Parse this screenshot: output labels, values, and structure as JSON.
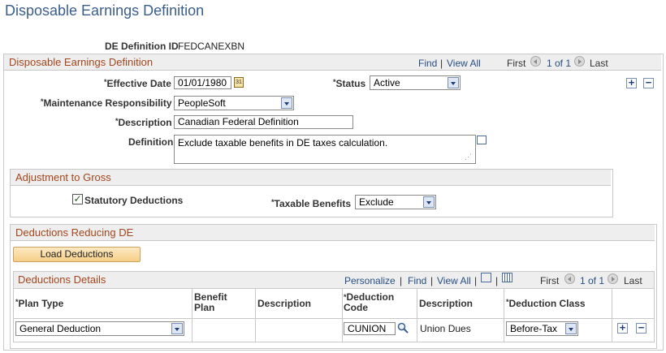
{
  "page": {
    "title": "Disposable Earnings Definition"
  },
  "header": {
    "id_label": "DE Definition ID",
    "id_value": "FEDCANEXBN"
  },
  "main": {
    "section_title": "Disposable Earnings Definition",
    "nav": {
      "find": "Find",
      "view_all": "View All",
      "first": "First",
      "count": "1 of 1",
      "last": "Last"
    },
    "effective_date": {
      "label": "Effective Date",
      "value": "01/01/1980"
    },
    "status": {
      "label": "Status",
      "value": "Active"
    },
    "maintenance": {
      "label": "Maintenance Responsibility",
      "value": "PeopleSoft"
    },
    "description": {
      "label": "Description",
      "value": "Canadian Federal Definition"
    },
    "definition": {
      "label": "Definition",
      "value": "Exclude taxable benefits in DE taxes calculation."
    },
    "required_mark": "*"
  },
  "adjustment": {
    "title": "Adjustment to Gross",
    "statutory": {
      "label": "Statutory Deductions",
      "checked": true
    },
    "taxable": {
      "label": "Taxable Benefits",
      "value": "Exclude"
    }
  },
  "deductions_reducing": {
    "title": "Deductions Reducing DE",
    "load_button": "Load Deductions"
  },
  "details": {
    "title": "Deductions Details",
    "nav": {
      "personalize": "Personalize",
      "find": "Find",
      "view_all": "View All",
      "first": "First",
      "count": "1 of 1",
      "last": "Last"
    },
    "columns": {
      "plan_type": "Plan Type",
      "benefit_plan_1": "Benefit",
      "benefit_plan_2": "Plan",
      "description": "Description",
      "deduction_code_1": "Deduction",
      "deduction_code_2": "Code",
      "description2": "Description",
      "deduction_class": "Deduction Class"
    },
    "rows": [
      {
        "plan_type": "General Deduction",
        "benefit_plan": "",
        "description": "",
        "deduction_code": "CUNION",
        "description2": "Union Dues",
        "deduction_class": "Before-Tax"
      }
    ]
  }
}
